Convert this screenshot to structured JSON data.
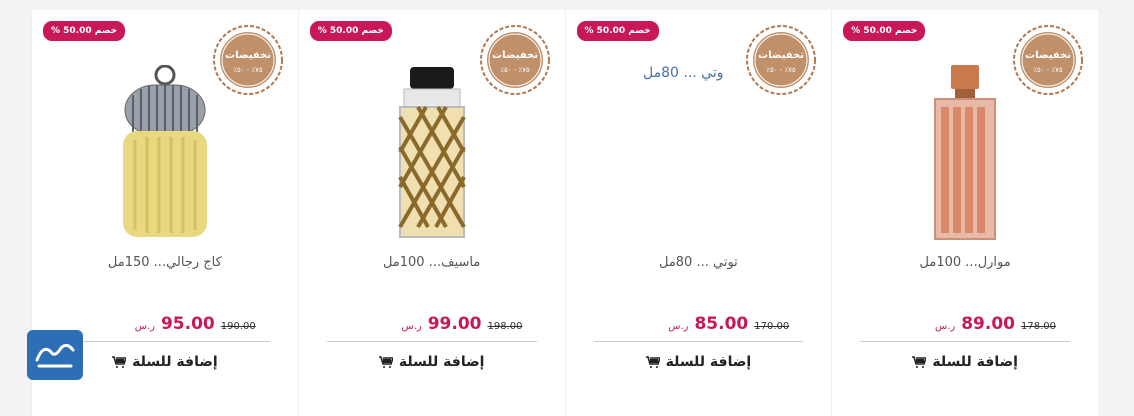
{
  "products": [
    {
      "name": "موارل... 100مل",
      "discount": "خصم 50.00 %",
      "old_price": "178.00",
      "price": "89.00",
      "currency": "ر.س",
      "add_to_cart": "إضافة للسلة",
      "image": "perfume-bottle-copper"
    },
    {
      "name": "توتي ... 80مل",
      "discount": "خصم 50.00 %",
      "old_price": "170.00",
      "price": "85.00",
      "currency": "ر.س",
      "add_to_cart": "إضافة للسلة",
      "image_alt": "وتي ... 80مل"
    },
    {
      "name": "ماسيف... 100مل",
      "discount": "خصم 50.00 %",
      "old_price": "198.00",
      "price": "99.00",
      "currency": "ر.س",
      "add_to_cart": "إضافة للسلة",
      "image": "perfume-bottle-lattice"
    },
    {
      "name": "كاج رجالي... 150مل",
      "discount": "خصم 50.00 %",
      "old_price": "190.00",
      "price": "95.00",
      "currency": "ر.س",
      "add_to_cart": "إضافة للسلة",
      "image": "perfume-bottle-cage"
    }
  ],
  "sale_seal": {
    "top": "تخفيضات",
    "bottom": "٧٥٪ - ٥٠٪"
  },
  "colors": {
    "accent": "#c8185a",
    "seal": "#b07a55",
    "logo": "#2c6fb7"
  }
}
